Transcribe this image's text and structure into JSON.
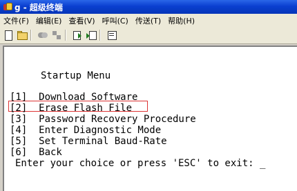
{
  "window": {
    "title": "g - 超级终端"
  },
  "menubar": {
    "items": [
      "文件(F)",
      "编辑(E)",
      "查看(V)",
      "呼叫(C)",
      "传送(T)",
      "帮助(H)"
    ]
  },
  "toolbar": {
    "buttons": [
      "new-icon",
      "open-icon",
      "connect-icon",
      "disconnect-icon",
      "send-icon",
      "receive-icon",
      "properties-icon"
    ]
  },
  "terminal": {
    "heading": "Startup Menu",
    "options": [
      "[1]  Download Software",
      "[2]  Erase Flash File",
      "[3]  Password Recovery Procedure",
      "[4]  Enter Diagnostic Mode",
      "[5]  Set Terminal Baud-Rate",
      "[6]  Back"
    ],
    "prompt": "Enter your choice or press 'ESC' to exit: _"
  },
  "colors": {
    "highlight_border": "#dd3333",
    "title_bar": "#0a3fd0"
  }
}
